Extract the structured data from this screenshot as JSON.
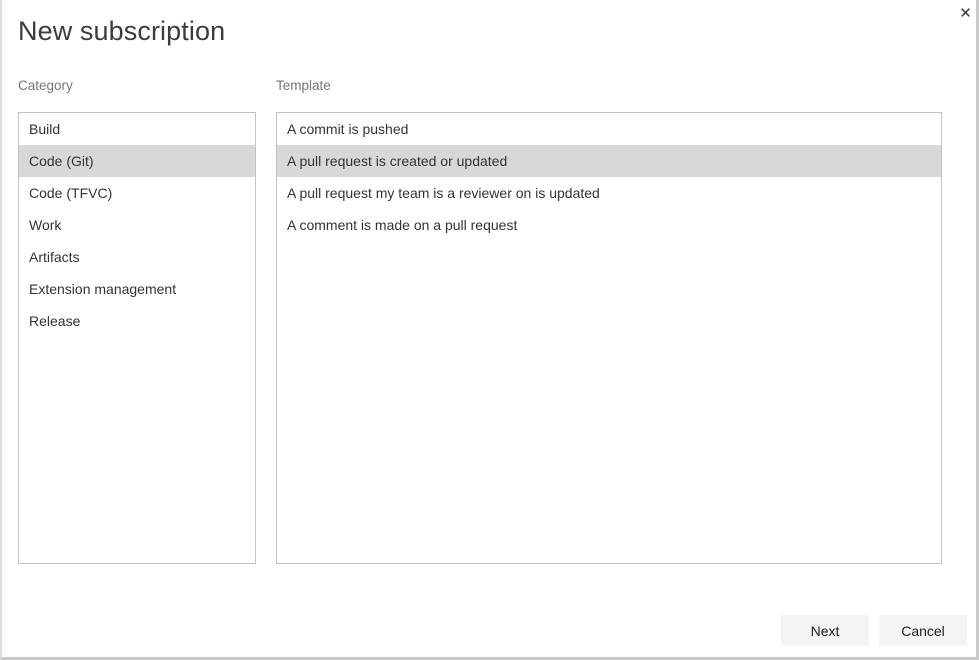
{
  "dialog": {
    "title": "New subscription",
    "close_icon": "close-icon",
    "close_glyph": "✕"
  },
  "category": {
    "label": "Category",
    "items": [
      {
        "label": "Build",
        "selected": false
      },
      {
        "label": "Code (Git)",
        "selected": true
      },
      {
        "label": "Code (TFVC)",
        "selected": false
      },
      {
        "label": "Work",
        "selected": false
      },
      {
        "label": "Artifacts",
        "selected": false
      },
      {
        "label": "Extension management",
        "selected": false
      },
      {
        "label": "Release",
        "selected": false
      }
    ]
  },
  "template": {
    "label": "Template",
    "items": [
      {
        "label": "A commit is pushed",
        "selected": false
      },
      {
        "label": "A pull request is created or updated",
        "selected": true
      },
      {
        "label": "A pull request my team is a reviewer on is updated",
        "selected": false
      },
      {
        "label": "A comment is made on a pull request",
        "selected": false
      }
    ]
  },
  "footer": {
    "next_label": "Next",
    "cancel_label": "Cancel"
  },
  "colors": {
    "selection": "#d8d8d8",
    "border": "#c2c2c2",
    "button_bg": "#f4f4f4",
    "label_text": "#767676",
    "body_text": "#333333"
  }
}
